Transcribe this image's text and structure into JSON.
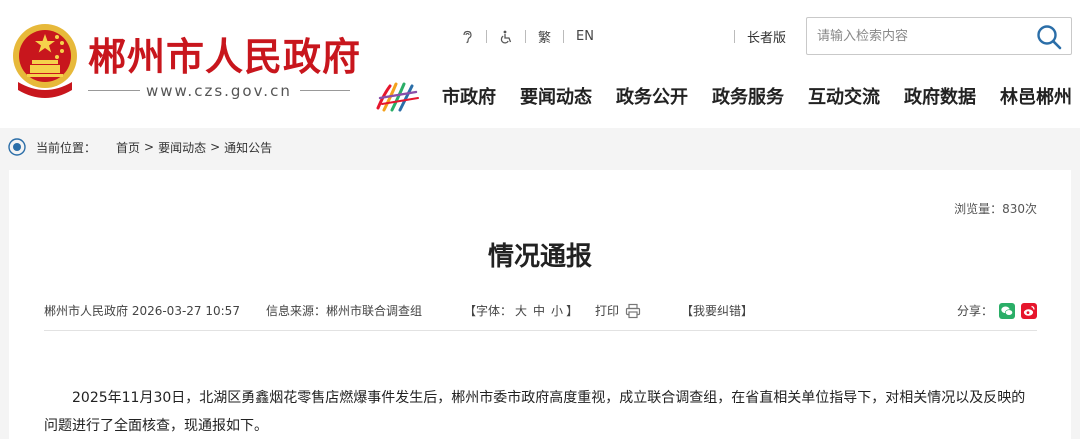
{
  "header": {
    "site_name": "郴州市人民政府",
    "domain": "www.czs.gov.cn",
    "tools": {
      "accessibility_text": "繁",
      "lang_en": "EN",
      "elder_mode": "长者版"
    },
    "search": {
      "placeholder": "请输入检索内容"
    },
    "nav": [
      "市政府",
      "要闻动态",
      "政务公开",
      "政务服务",
      "互动交流",
      "政府数据",
      "林邑郴州"
    ]
  },
  "breadcrumb": {
    "label": "当前位置：",
    "items": [
      "首页",
      "要闻动态",
      "通知公告"
    ],
    "separator": ">"
  },
  "article": {
    "views": "浏览量：830次",
    "title": "情况通报",
    "meta": {
      "publisher_date": "郴州市人民政府 2026-03-27 10:57",
      "source": "信息来源：郴州市联合调查组",
      "font_open": "【字体：",
      "font_large": "大",
      "font_medium": "中",
      "font_small": "小",
      "font_close": "】",
      "print": "打印",
      "report_error": "【我要纠错】",
      "share": "分享："
    },
    "body": "2025年11月30日，北湖区勇鑫烟花零售店燃爆事件发生后，郴州市委市政府高度重视，成立联合调查组，在省直相关单位指导下，对相关情况以及反映的问题进行了全面核查，现通报如下。"
  },
  "colors": {
    "brand_red": "#c8161d",
    "emblem_gold": "#e7b93a",
    "wechat_green": "#2aae67",
    "weibo_red": "#e6162d"
  }
}
